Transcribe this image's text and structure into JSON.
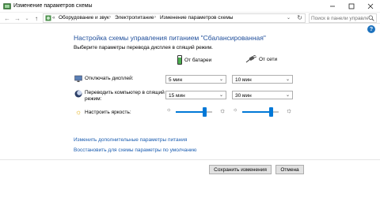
{
  "window": {
    "title": "Изменение параметров схемы"
  },
  "address": {
    "crumbs": [
      "Оборудование и звук",
      "Электропитание",
      "Изменение параметров схемы"
    ],
    "overflow": "«"
  },
  "search": {
    "placeholder": "Поиск в панели управления"
  },
  "main": {
    "heading": "Настройка схемы управления питанием \"Сбалансированная\"",
    "subheading": "Выберите параметры перевода дисплея в спящий режим.",
    "columns": {
      "battery": "От батареи",
      "ac": "От сети"
    },
    "rows": {
      "display_off": {
        "label": "Отключать дисплей:",
        "battery_value": "5 мин",
        "ac_value": "10 мин"
      },
      "sleep": {
        "label_line1": "Переводить компьютер в спящий",
        "label_line2": "режим:",
        "battery_value": "15 мин",
        "ac_value": "30 мин"
      },
      "brightness": {
        "label": "Настроить яркость:",
        "battery_level": 0.82,
        "ac_level": 0.82
      }
    }
  },
  "links": {
    "advanced": "Изменить дополнительные параметры питания",
    "restore": "Восстановить для схемы параметры по умолчанию"
  },
  "buttons": {
    "save": "Сохранить изменения",
    "cancel": "Отмена"
  }
}
